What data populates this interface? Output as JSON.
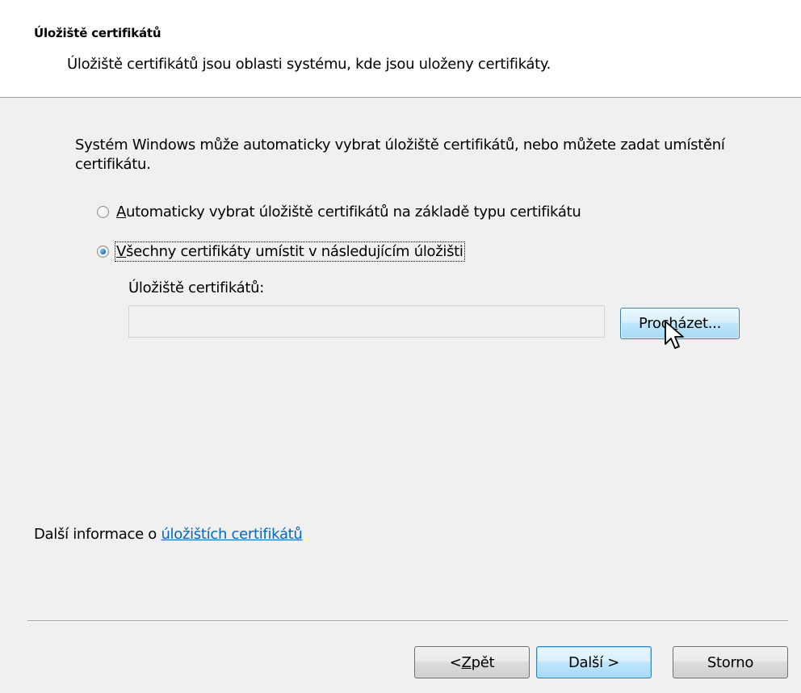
{
  "header": {
    "title": "Úložiště certifikátů",
    "description": "Úložiště certifikátů jsou oblasti systému, kde jsou uloženy certifikáty."
  },
  "intro_text": "Systém Windows může automaticky vybrat úložiště certifikátů, nebo můžete zadat umístění certifikátu.",
  "options": [
    {
      "label_hotkey": "A",
      "label_rest": "utomaticky vybrat úložiště certifikátů na základě typu certifikátu",
      "selected": false
    },
    {
      "label_hotkey": "V",
      "label_rest": "šechny certifikáty umístit v následujícím úložišti",
      "selected": true
    }
  ],
  "store_field": {
    "label": "Úložiště certifikátů:",
    "value": ""
  },
  "browse_button": {
    "label_pre": "Proc",
    "label_hotkey": "h",
    "label_post": "ázet..."
  },
  "more_info": {
    "prefix": "Další informace o ",
    "link_text": "úložištích certifikátů"
  },
  "buttons": {
    "back_pre": "< ",
    "back_hotkey": "Z",
    "back_post": "pět",
    "next": "Další >",
    "cancel": "Storno"
  },
  "colors": {
    "link": "#0066cc",
    "header_bg": "#ffffff",
    "body_bg": "#f0f0f0",
    "default_button_border": "#3c7fb1"
  },
  "icons": {
    "cursor": "arrow-pointer-icon"
  }
}
